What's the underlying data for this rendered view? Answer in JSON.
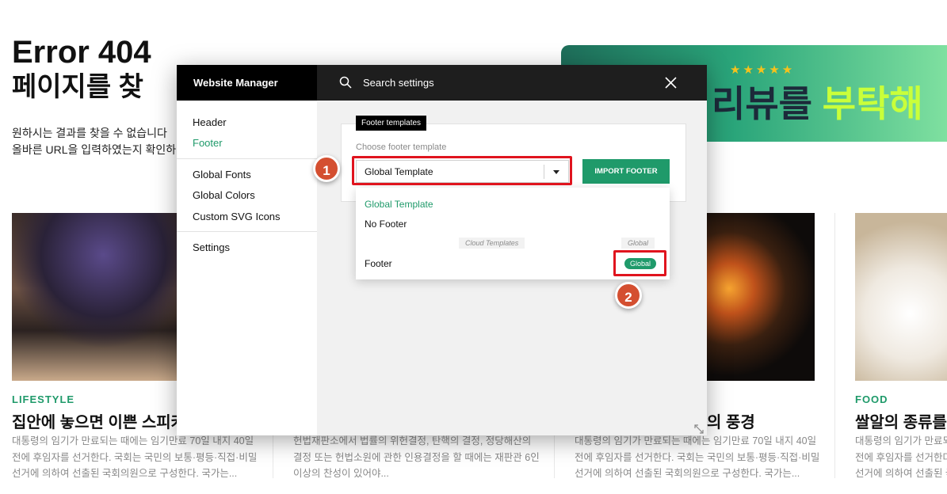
{
  "background_page": {
    "error_title": "Error 404",
    "error_title_line2": "페이지를 찾",
    "error_text_line1": "원하시는 결과를 찾을 수 없습니다",
    "error_text_line2": "올바른 URL을 입력하였는지 확인하",
    "banner_stars": "★★★★★",
    "banner_text_a": "리뷰를 ",
    "banner_text_b": "부탁해",
    "cards": [
      {
        "category": "LIFESTYLE",
        "title": "집안에 놓으면 이쁜 스피커",
        "body1": "대통령의 임기가 만료되는 때에는 임기만료 70일 내지 40일",
        "body2": "전에 후임자를 선거한다. 국회는 국민의 보통·평등·직접·비밀",
        "body3": "선거에 의하여 선출된 국회의원으로 구성한다. 국가는..."
      },
      {
        "category": "",
        "title": "",
        "body1": "헌법재판소에서 법률의 위헌결정, 탄핵의 결정, 정당해산의",
        "body2": "결정 또는 헌법소원에 관한 인용결정을 할 때에는 재판관 6인",
        "body3": "이상의 찬성이 있어야..."
      },
      {
        "category": "",
        "title": "의 풍경",
        "body1": "대통령의 임기가 만료되는 때에는 임기만료 70일 내지 40일",
        "body2": "전에 후임자를 선거한다. 국회는 국민의 보통·평등·직접·비밀",
        "body3": "선거에 의하여 선출된 국회의원으로 구성한다. 국가는..."
      },
      {
        "category": "FOOD",
        "title": "쌀알의 종류를 알",
        "body1": "대통령의 임기가 만료되는 때",
        "body2": "전에 후임자를 선거한다. 국회",
        "body3": "선거에 의하여 선출된 국회의"
      }
    ]
  },
  "modal": {
    "brand": "Website Manager",
    "search_label": "Search settings",
    "sidebar": {
      "items": [
        "Header",
        "Footer",
        "Global Fonts",
        "Global Colors",
        "Custom SVG Icons",
        "Settings"
      ],
      "active": "Footer"
    },
    "panel": {
      "tag": "Footer templates",
      "field_label": "Choose footer template",
      "selected_value": "Global Template",
      "import_button": "IMPORT FOOTER"
    },
    "dropdown": {
      "options": [
        "Global Template",
        "No Footer"
      ],
      "group_label": "Cloud Templates",
      "group_tag": "Global",
      "cloud_item": "Footer",
      "cloud_item_badge": "Global"
    }
  },
  "annotations": {
    "step1": "1",
    "step2": "2",
    "highlight_color": "#e0141e",
    "step_color": "#d44f30"
  },
  "colors": {
    "accent": "#1f9a6a",
    "header_bg": "#1e1e1e"
  }
}
